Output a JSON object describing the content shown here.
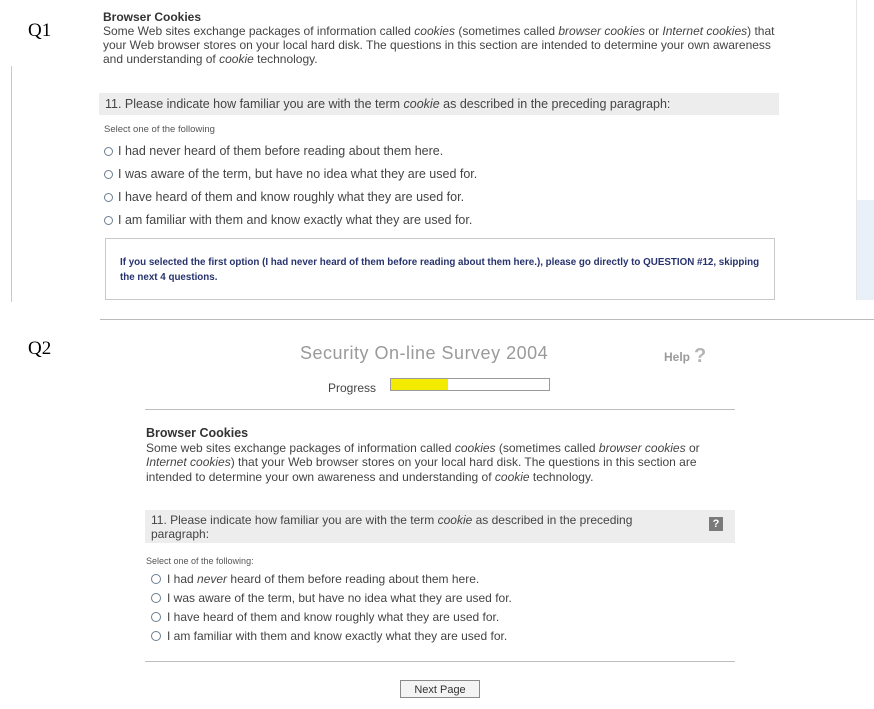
{
  "labels": {
    "q1": "Q1",
    "q2": "Q2"
  },
  "q1": {
    "section_title": "Browser Cookies",
    "intro": [
      "Some Web sites exchange packages of information called ",
      "cookies",
      " (sometimes called ",
      "browser cookies",
      " or ",
      "Internet cookies",
      ") that your Web browser stores on your local hard disk. The questions in this section are intended to determine your own awareness and understanding of ",
      "cookie",
      " technology."
    ],
    "question": [
      "11. Please indicate how familiar you are with the term ",
      "cookie",
      " as described in the preceding paragraph:"
    ],
    "select_prompt": "Select one of the following",
    "options": [
      "I had never heard of them before reading about them here.",
      "I was aware of the term, but have no idea what they are used for.",
      "I have heard of them and know roughly what they are used for.",
      "I am familiar with them and know exactly what they are used for."
    ],
    "note": "If you selected the first option (I had never heard of them before reading about them here.), please go directly to QUESTION #12, skipping the next 4 questions."
  },
  "q2": {
    "survey_title": "Security On-line Survey 2004",
    "help_label": "Help",
    "help_icon": "?",
    "progress_label": "Progress",
    "progress_fraction": 0.36,
    "section_title": "Browser Cookies",
    "intro": [
      "Some web sites exchange packages of information called ",
      "cookies",
      " (sometimes called ",
      "browser cookies",
      " or ",
      "Internet cookies",
      ") that your Web browser stores on your local hard disk. The questions in this section are intended to determine your own awareness and understanding of ",
      "cookie",
      " technology."
    ],
    "question": [
      "11. Please indicate how familiar you are with the term ",
      "cookie",
      " as described in the preceding paragraph:"
    ],
    "question_help_icon": "?",
    "select_prompt": "Select one of the following:",
    "option1": [
      "I had ",
      "never",
      " heard of them before reading about them here."
    ],
    "options_rest": [
      "I was aware of the term, but have no idea what they are used for.",
      "I have heard of them and know roughly what they are used for.",
      "I am familiar with them and know exactly what they are used for."
    ],
    "next_button": "Next Page"
  },
  "colors": {
    "progress_fill": "#f3ec00",
    "note_text": "#27336e",
    "question_bg": "#ededed"
  }
}
